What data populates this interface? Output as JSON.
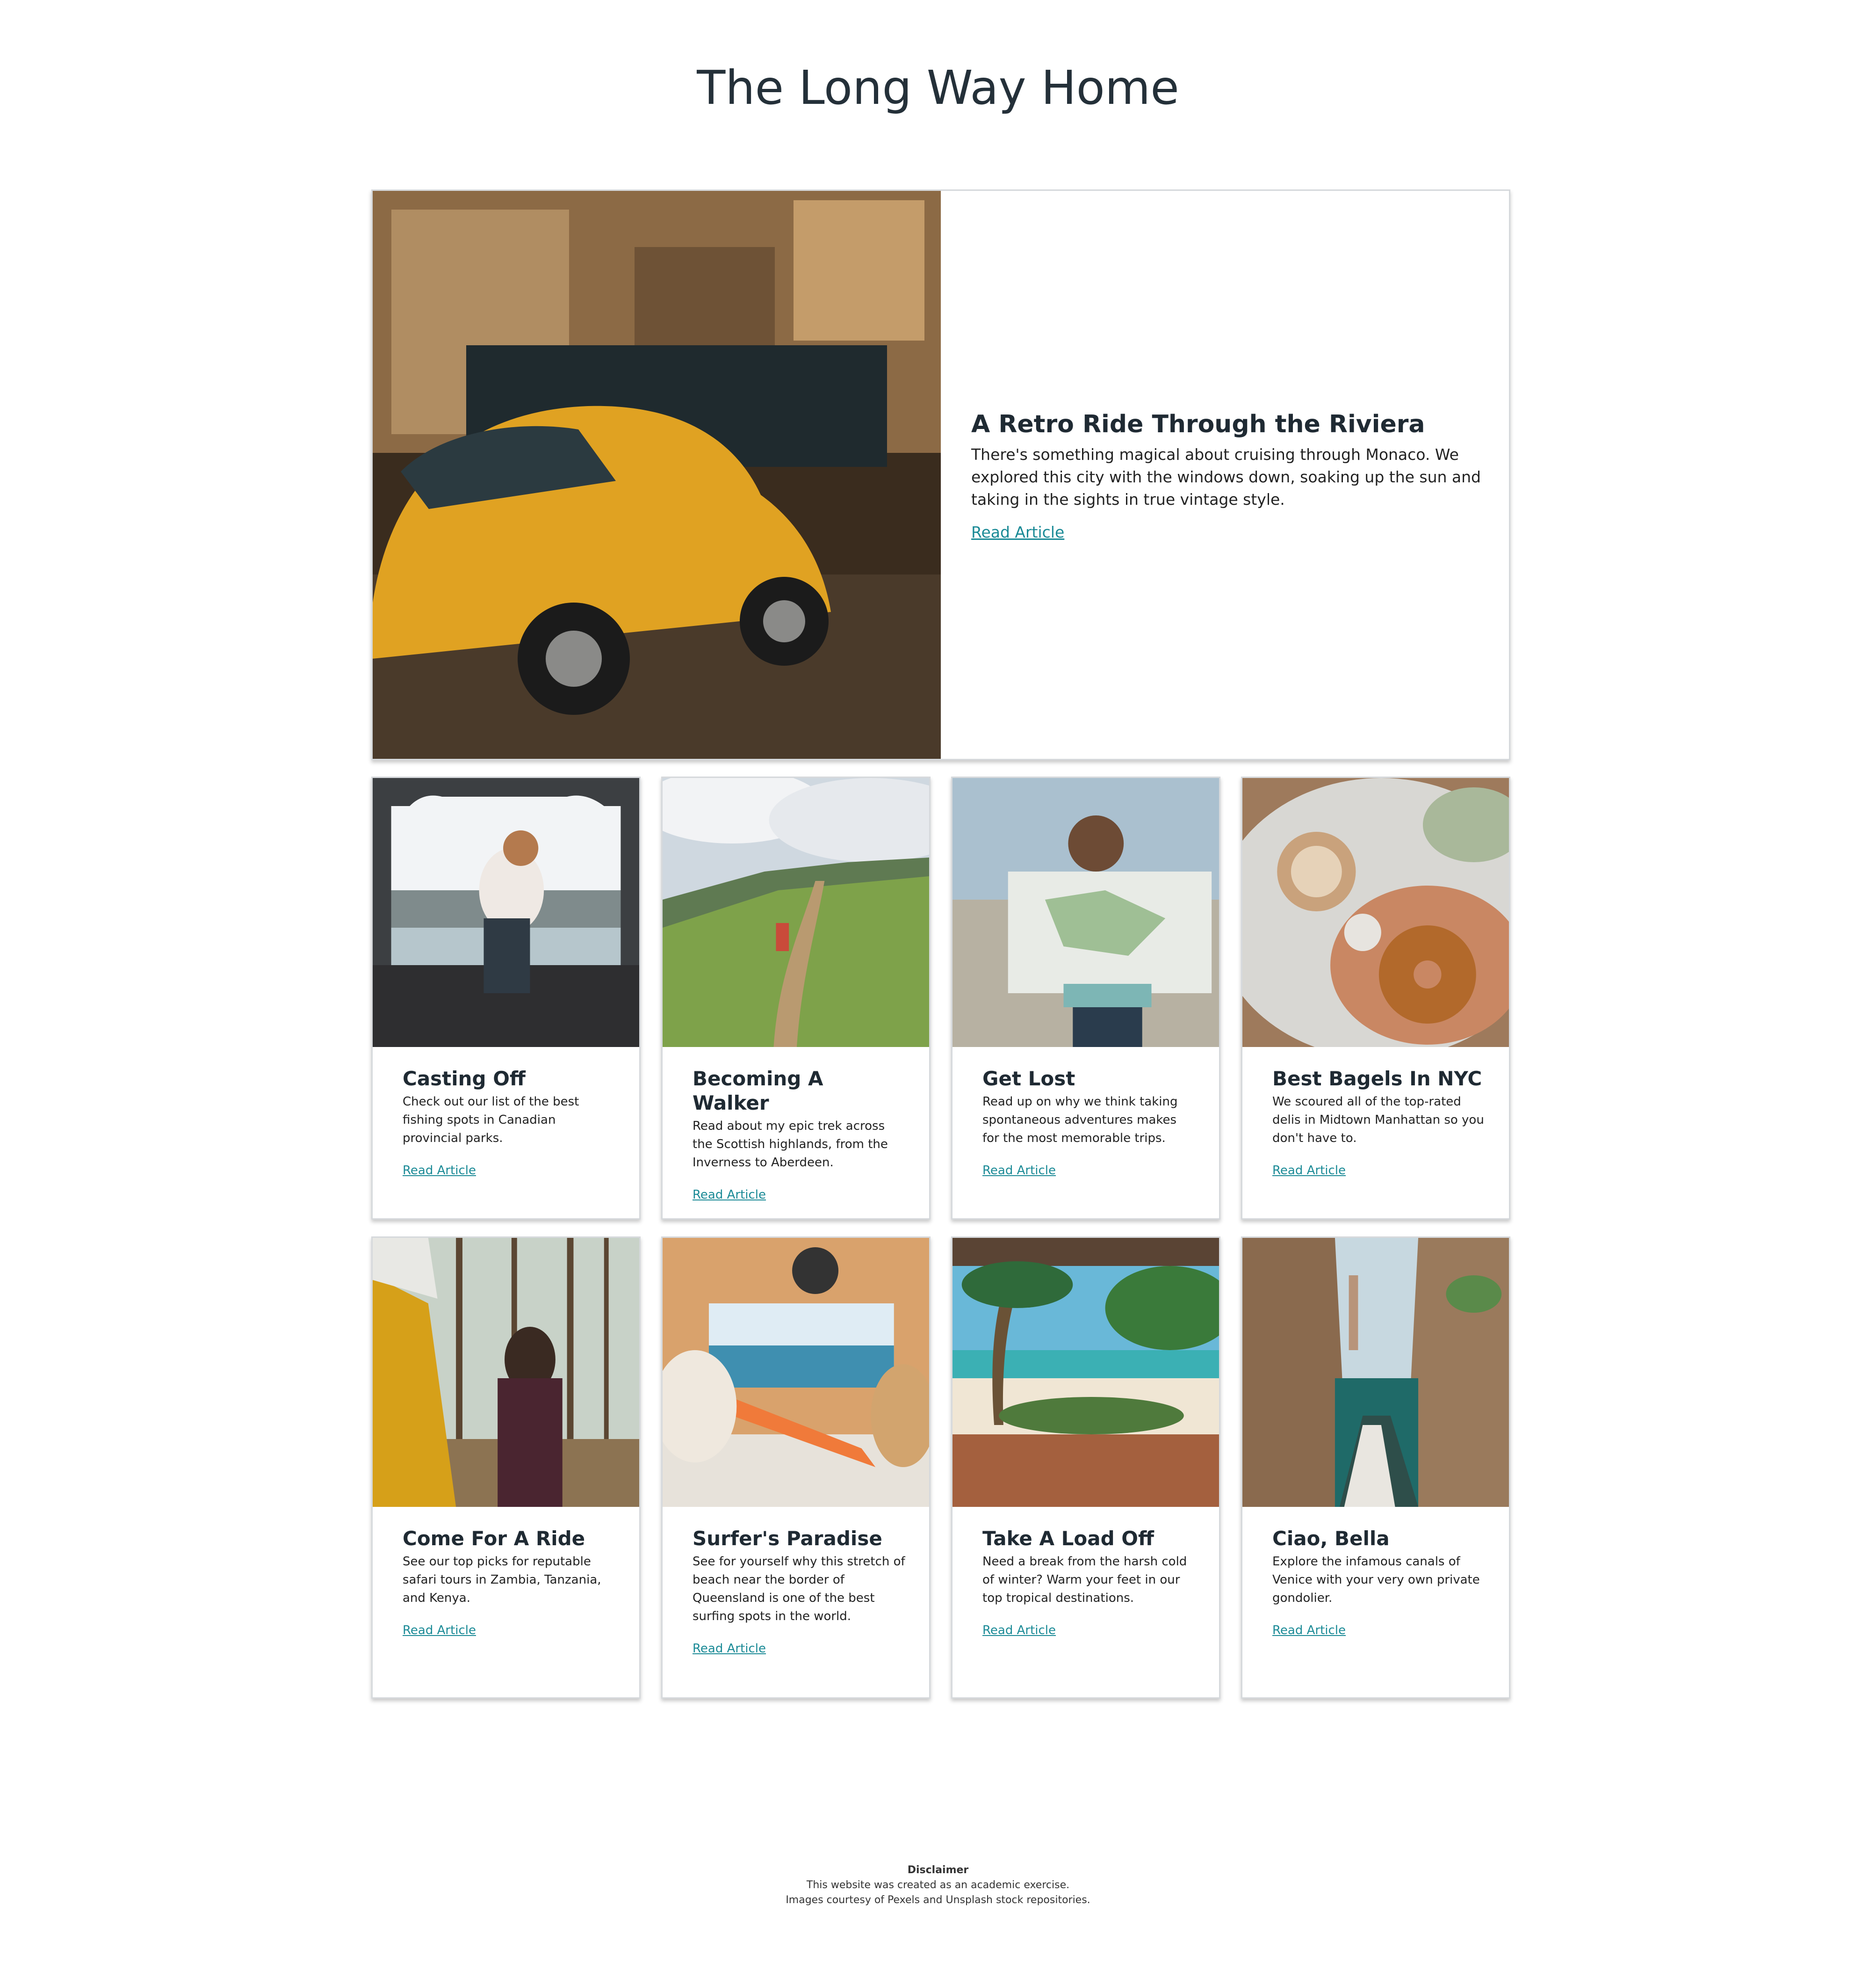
{
  "page_title": "The Long Way Home",
  "featured": {
    "title": "A Retro Ride Through the Riviera",
    "text": "There's something magical about cruising through Monaco. We explored this city with the windows down, soaking up the sun and taking in the sights in true vintage style.",
    "link": "Read Article",
    "image": "yellow-vintage-beetle-photo"
  },
  "articles": [
    {
      "title": "Casting Off",
      "text": "Check out our list of the best fishing spots in Canadian provincial parks.",
      "link": "Read Article",
      "image": "man-fishing-from-van-photo"
    },
    {
      "title": "Becoming A Walker",
      "text": "Read about my epic trek across the Scottish highlands, from the Inverness to Aberdeen.",
      "link": "Read Article",
      "image": "hiker-on-ridge-photo"
    },
    {
      "title": "Get Lost",
      "text": "Read up on why we think taking spontaneous adventures makes for the most memorable trips.",
      "link": "Read Article",
      "image": "woman-reading-map-photo"
    },
    {
      "title": "Best Bagels In NYC",
      "text": "We scoured all of the top-rated delis in Midtown Manhattan so you don't have to.",
      "link": "Read Article",
      "image": "bagel-and-coffee-photo"
    },
    {
      "title": "Come For A Ride",
      "text": "See our top picks for reputable safari tours in Zambia, Tanzania, and Kenya.",
      "link": "Read Article",
      "image": "woman-by-yellow-van-in-forest-photo"
    },
    {
      "title": "Surfer's Paradise",
      "text": "See for yourself why this stretch of beach near the border of Queensland is one of the best surfing spots in the world.",
      "link": "Read Article",
      "image": "van-view-of-beach-with-surfboard-photo"
    },
    {
      "title": "Take A Load Off",
      "text": "Need a break from the harsh cold of winter? Warm your feet in our top tropical destinations.",
      "link": "Read Article",
      "image": "tropical-beach-palms-photo"
    },
    {
      "title": "Ciao, Bella",
      "text": "Explore the infamous canals of Venice with your very own private gondolier.",
      "link": "Read Article",
      "image": "venice-canal-gondola-photo"
    }
  ],
  "footer": {
    "heading": "Disclaimer",
    "line1": "This website was created as an academic exercise.",
    "line2": "Images courtesy of Pexels and Unsplash stock repositories."
  },
  "colors": {
    "link": "#1a8a96",
    "title": "#243039"
  }
}
